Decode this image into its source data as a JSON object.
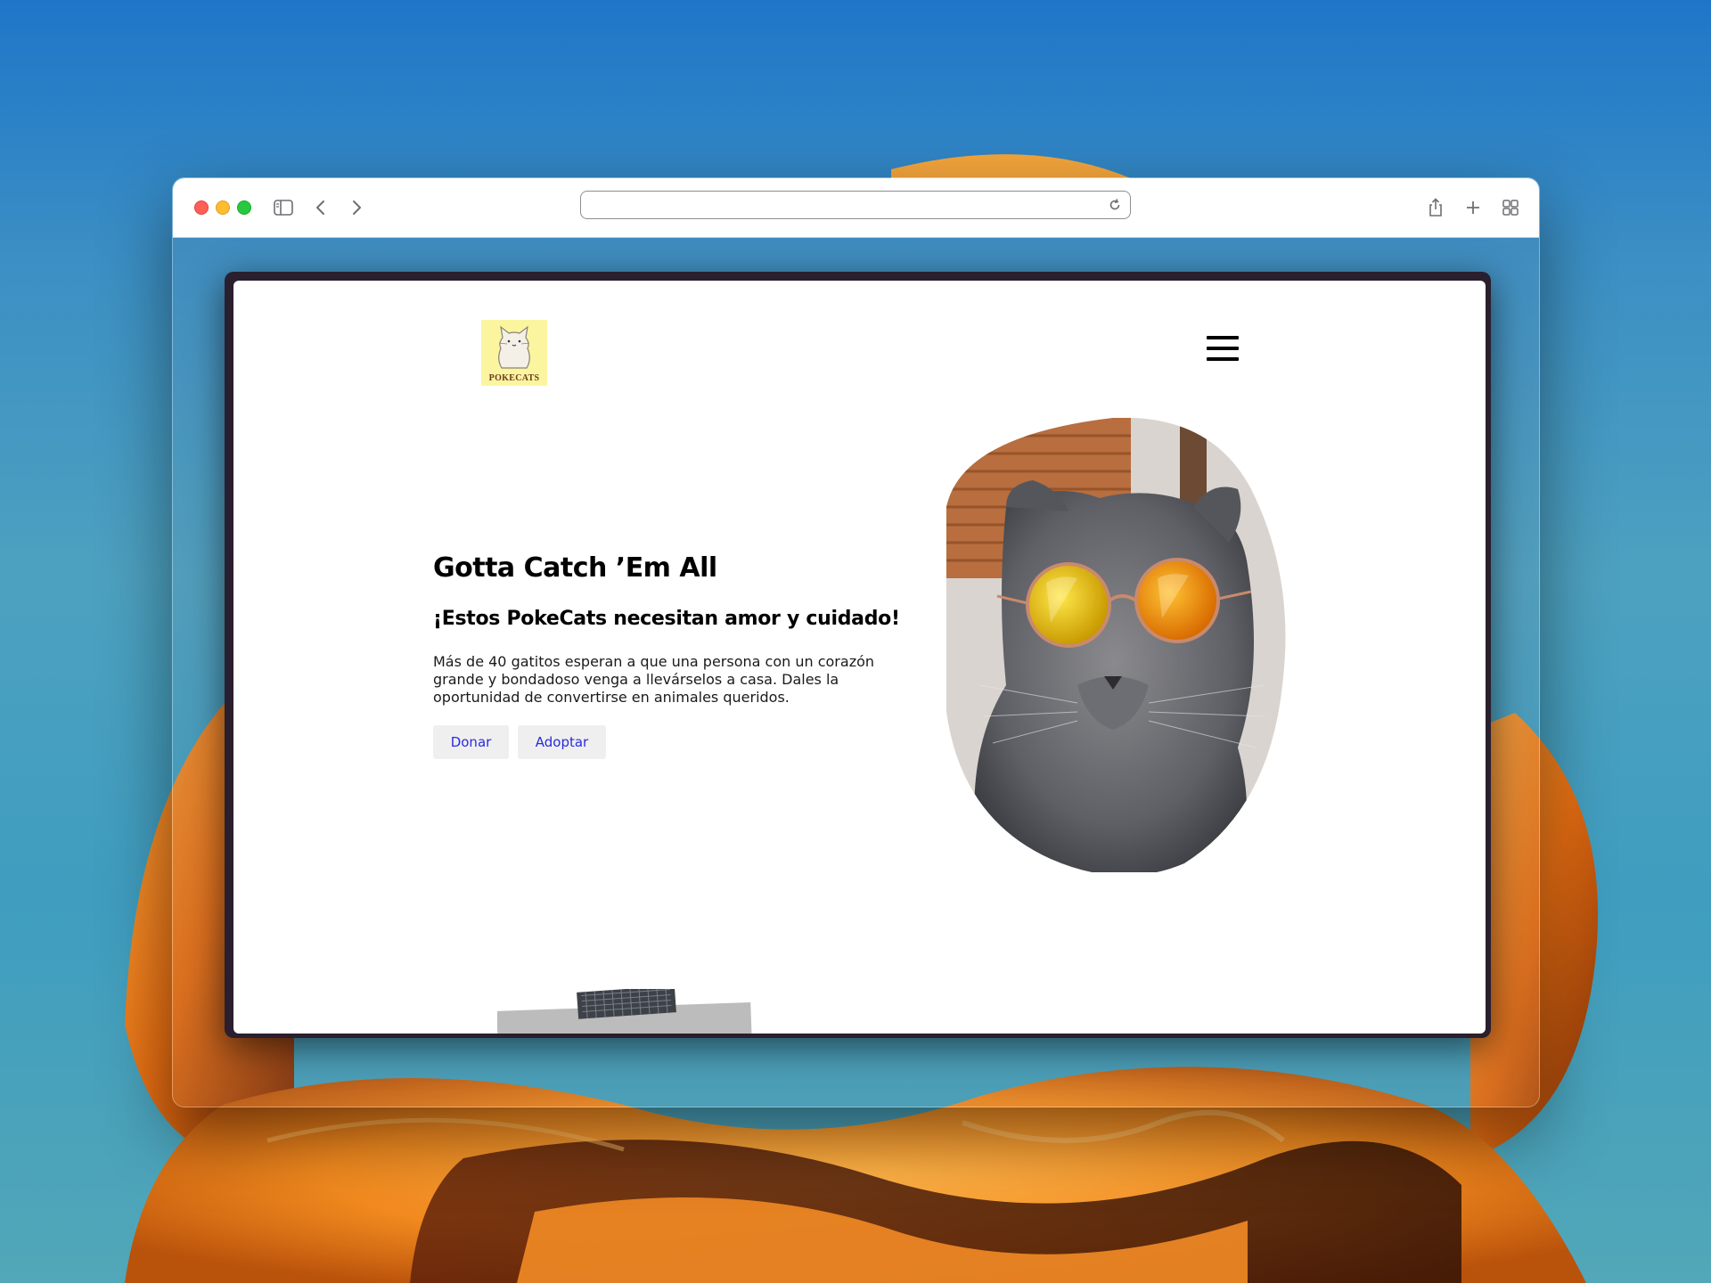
{
  "colors": {
    "accent_link": "#2a2ae0",
    "logo_bg": "#fbf5a0",
    "button_bg": "#efefef"
  },
  "browser": {
    "address_value": "",
    "icons": [
      "sidebar-icon",
      "back-icon",
      "forward-icon",
      "reload-icon",
      "share-icon",
      "new-tab-icon",
      "tab-overview-icon"
    ]
  },
  "site": {
    "logo_text": "POKECATS",
    "menu_icon": "hamburger-menu-icon",
    "hero": {
      "title": "Gotta Catch ’Em All",
      "subtitle": "¡Estos PokeCats necesitan amor y cuidado!",
      "description": "Más de 40 gatitos esperan a que una persona con un corazón grande y bondadoso venga a llevárselos a casa. Dales la oportunidad de convertirse en animales queridos.",
      "donate_label": "Donar",
      "adopt_label": "Adoptar"
    }
  }
}
